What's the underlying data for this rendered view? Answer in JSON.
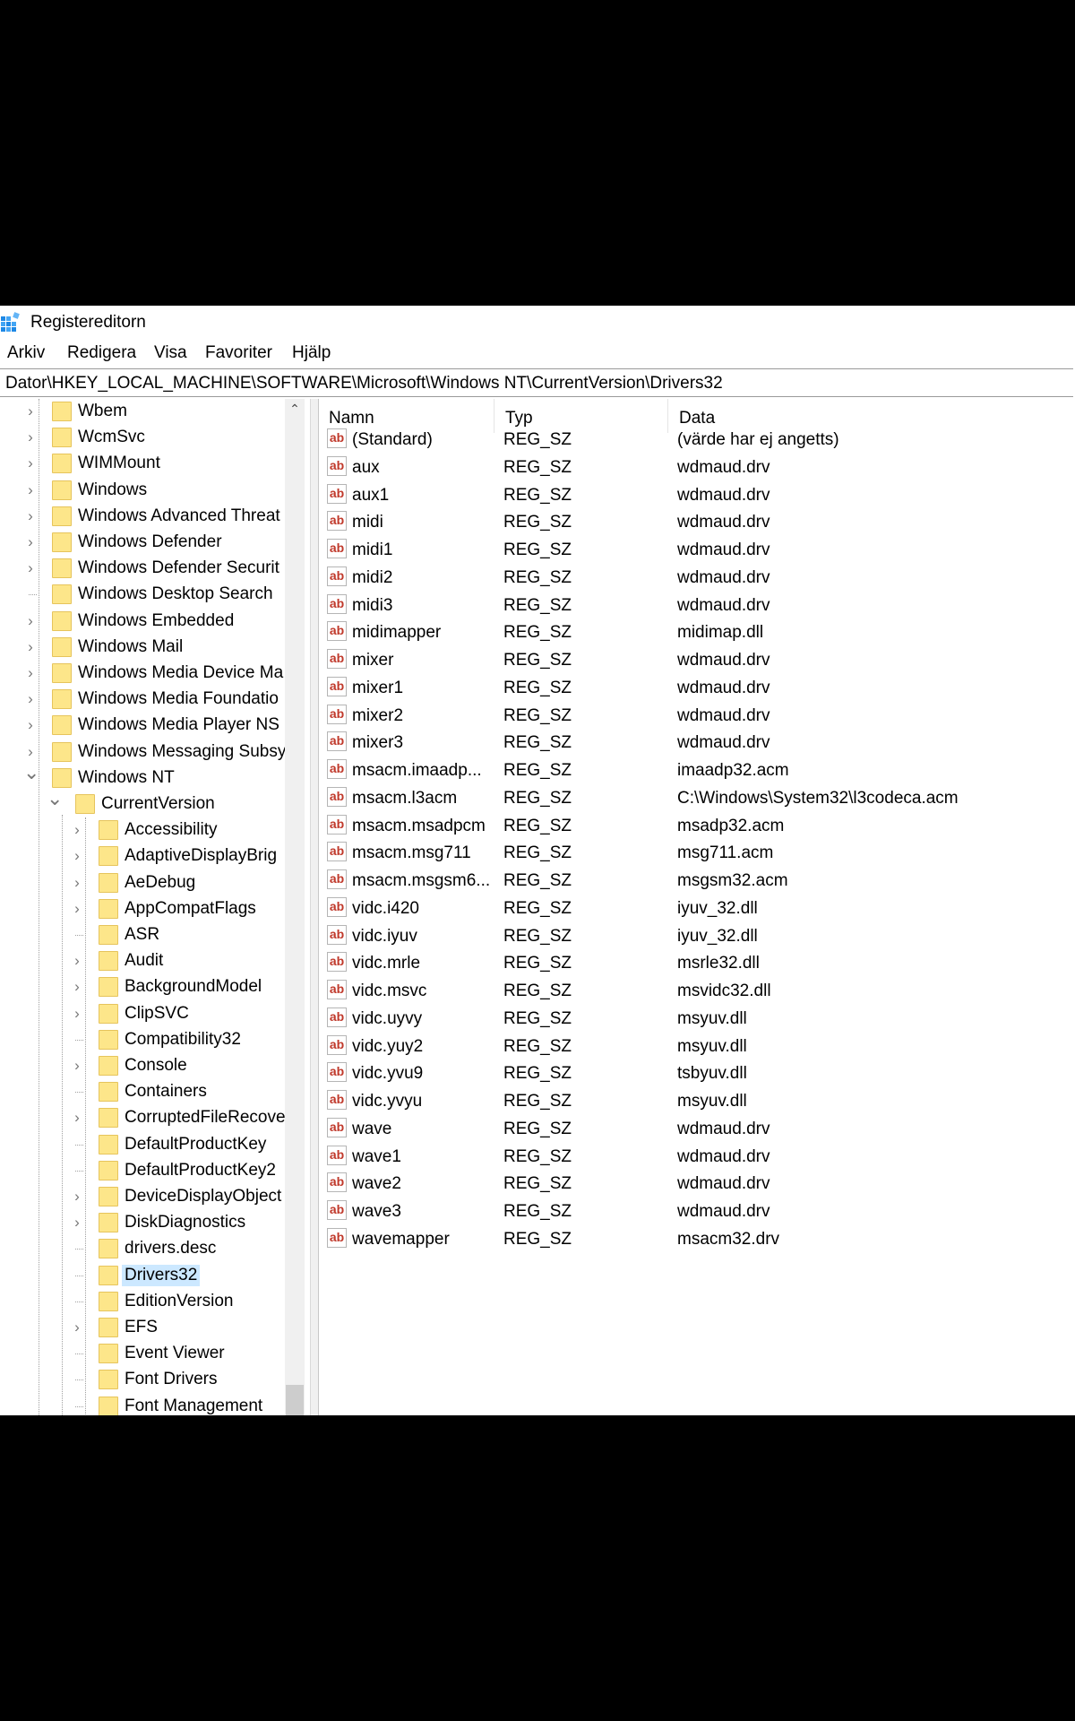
{
  "window": {
    "title": "Registereditorn",
    "app_icon": "registry-editor-icon"
  },
  "menu": [
    "Arkiv",
    "Redigera",
    "Visa",
    "Favoriter",
    "Hjälp"
  ],
  "address": "Dator\\HKEY_LOCAL_MACHINE\\SOFTWARE\\Microsoft\\Windows NT\\CurrentVersion\\Drivers32",
  "tree": [
    {
      "label": "Wbem",
      "level": 1,
      "expander": true
    },
    {
      "label": "WcmSvc",
      "level": 1,
      "expander": true
    },
    {
      "label": "WIMMount",
      "level": 1,
      "expander": true
    },
    {
      "label": "Windows",
      "level": 1,
      "expander": true
    },
    {
      "label": "Windows Advanced Threat",
      "level": 1,
      "expander": true
    },
    {
      "label": "Windows Defender",
      "level": 1,
      "expander": true
    },
    {
      "label": "Windows Defender Securit",
      "level": 1,
      "expander": true
    },
    {
      "label": "Windows Desktop Search",
      "level": 1,
      "expander": false
    },
    {
      "label": "Windows Embedded",
      "level": 1,
      "expander": true
    },
    {
      "label": "Windows Mail",
      "level": 1,
      "expander": true
    },
    {
      "label": "Windows Media Device Ma",
      "level": 1,
      "expander": true
    },
    {
      "label": "Windows Media Foundatio",
      "level": 1,
      "expander": true
    },
    {
      "label": "Windows Media Player NS",
      "level": 1,
      "expander": true
    },
    {
      "label": "Windows Messaging Subsy",
      "level": 1,
      "expander": true
    },
    {
      "label": "Windows NT",
      "level": 1,
      "expander": true,
      "expanded": true
    },
    {
      "label": "CurrentVersion",
      "level": 2,
      "expander": true,
      "expanded": true
    },
    {
      "label": "Accessibility",
      "level": 3,
      "expander": true
    },
    {
      "label": "AdaptiveDisplayBrig",
      "level": 3,
      "expander": true
    },
    {
      "label": "AeDebug",
      "level": 3,
      "expander": true
    },
    {
      "label": "AppCompatFlags",
      "level": 3,
      "expander": true
    },
    {
      "label": "ASR",
      "level": 3,
      "expander": false
    },
    {
      "label": "Audit",
      "level": 3,
      "expander": true
    },
    {
      "label": "BackgroundModel",
      "level": 3,
      "expander": true
    },
    {
      "label": "ClipSVC",
      "level": 3,
      "expander": true
    },
    {
      "label": "Compatibility32",
      "level": 3,
      "expander": false
    },
    {
      "label": "Console",
      "level": 3,
      "expander": true
    },
    {
      "label": "Containers",
      "level": 3,
      "expander": false
    },
    {
      "label": "CorruptedFileRecove",
      "level": 3,
      "expander": true
    },
    {
      "label": "DefaultProductKey",
      "level": 3,
      "expander": false
    },
    {
      "label": "DefaultProductKey2",
      "level": 3,
      "expander": false
    },
    {
      "label": "DeviceDisplayObject",
      "level": 3,
      "expander": true
    },
    {
      "label": "DiskDiagnostics",
      "level": 3,
      "expander": true
    },
    {
      "label": "drivers.desc",
      "level": 3,
      "expander": false
    },
    {
      "label": "Drivers32",
      "level": 3,
      "expander": false,
      "selected": true
    },
    {
      "label": "EditionVersion",
      "level": 3,
      "expander": false
    },
    {
      "label": "EFS",
      "level": 3,
      "expander": true
    },
    {
      "label": "Event Viewer",
      "level": 3,
      "expander": false
    },
    {
      "label": "Font Drivers",
      "level": 3,
      "expander": false
    },
    {
      "label": "Font Management",
      "level": 3,
      "expander": false
    }
  ],
  "columns": [
    "Namn",
    "Typ",
    "Data"
  ],
  "values": [
    {
      "name": "(Standard)",
      "type": "REG_SZ",
      "data": "(värde har ej angetts)"
    },
    {
      "name": "aux",
      "type": "REG_SZ",
      "data": "wdmaud.drv"
    },
    {
      "name": "aux1",
      "type": "REG_SZ",
      "data": "wdmaud.drv"
    },
    {
      "name": "midi",
      "type": "REG_SZ",
      "data": "wdmaud.drv"
    },
    {
      "name": "midi1",
      "type": "REG_SZ",
      "data": "wdmaud.drv"
    },
    {
      "name": "midi2",
      "type": "REG_SZ",
      "data": "wdmaud.drv"
    },
    {
      "name": "midi3",
      "type": "REG_SZ",
      "data": "wdmaud.drv"
    },
    {
      "name": "midimapper",
      "type": "REG_SZ",
      "data": "midimap.dll"
    },
    {
      "name": "mixer",
      "type": "REG_SZ",
      "data": "wdmaud.drv"
    },
    {
      "name": "mixer1",
      "type": "REG_SZ",
      "data": "wdmaud.drv"
    },
    {
      "name": "mixer2",
      "type": "REG_SZ",
      "data": "wdmaud.drv"
    },
    {
      "name": "mixer3",
      "type": "REG_SZ",
      "data": "wdmaud.drv"
    },
    {
      "name": "msacm.imaadp...",
      "type": "REG_SZ",
      "data": "imaadp32.acm"
    },
    {
      "name": "msacm.l3acm",
      "type": "REG_SZ",
      "data": "C:\\Windows\\System32\\l3codeca.acm"
    },
    {
      "name": "msacm.msadpcm",
      "type": "REG_SZ",
      "data": "msadp32.acm"
    },
    {
      "name": "msacm.msg711",
      "type": "REG_SZ",
      "data": "msg711.acm"
    },
    {
      "name": "msacm.msgsm6...",
      "type": "REG_SZ",
      "data": "msgsm32.acm"
    },
    {
      "name": "vidc.i420",
      "type": "REG_SZ",
      "data": "iyuv_32.dll"
    },
    {
      "name": "vidc.iyuv",
      "type": "REG_SZ",
      "data": "iyuv_32.dll"
    },
    {
      "name": "vidc.mrle",
      "type": "REG_SZ",
      "data": "msrle32.dll"
    },
    {
      "name": "vidc.msvc",
      "type": "REG_SZ",
      "data": "msvidc32.dll"
    },
    {
      "name": "vidc.uyvy",
      "type": "REG_SZ",
      "data": "msyuv.dll"
    },
    {
      "name": "vidc.yuy2",
      "type": "REG_SZ",
      "data": "msyuv.dll"
    },
    {
      "name": "vidc.yvu9",
      "type": "REG_SZ",
      "data": "tsbyuv.dll"
    },
    {
      "name": "vidc.yvyu",
      "type": "REG_SZ",
      "data": "msyuv.dll"
    },
    {
      "name": "wave",
      "type": "REG_SZ",
      "data": "wdmaud.drv"
    },
    {
      "name": "wave1",
      "type": "REG_SZ",
      "data": "wdmaud.drv"
    },
    {
      "name": "wave2",
      "type": "REG_SZ",
      "data": "wdmaud.drv"
    },
    {
      "name": "wave3",
      "type": "REG_SZ",
      "data": "wdmaud.drv"
    },
    {
      "name": "wavemapper",
      "type": "REG_SZ",
      "data": "msacm32.drv"
    }
  ],
  "value_icon": "ab-string-icon"
}
